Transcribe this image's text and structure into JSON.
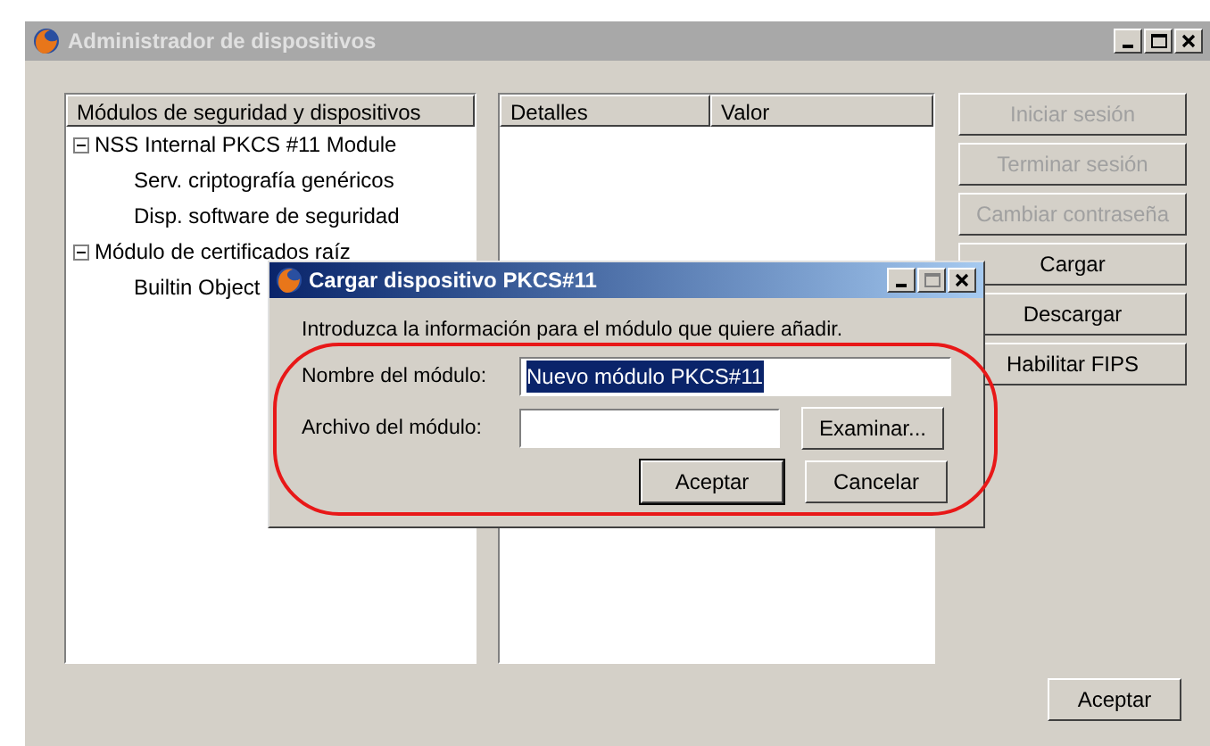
{
  "window": {
    "title": "Administrador de dispositivos"
  },
  "tree": {
    "columns": [
      "Módulos de seguridad y dispositivos"
    ],
    "items": [
      {
        "label": "NSS Internal PKCS #11 Module",
        "expanded": true,
        "children": [
          {
            "label": "Serv. criptografía genéricos"
          },
          {
            "label": "Disp. software de seguridad"
          }
        ]
      },
      {
        "label": "Módulo de certificados raíz",
        "expanded": true,
        "children": [
          {
            "label": "Builtin Object"
          }
        ]
      }
    ]
  },
  "details": {
    "columns": [
      "Detalles",
      "Valor"
    ]
  },
  "side_buttons": [
    {
      "label": "Iniciar sesión",
      "disabled": true
    },
    {
      "label": "Terminar sesión",
      "disabled": true
    },
    {
      "label": "Cambiar contraseña",
      "disabled": true
    },
    {
      "label": "Cargar",
      "disabled": false
    },
    {
      "label": "Descargar",
      "disabled": false
    },
    {
      "label": "Habilitar FIPS",
      "disabled": false
    }
  ],
  "ok_button": "Aceptar",
  "dialog": {
    "title": "Cargar dispositivo PKCS#11",
    "message": "Introduzca la información para el módulo que quiere añadir.",
    "fields": [
      {
        "label": "Nombre del módulo:",
        "value": "Nuevo módulo PKCS#11",
        "selected": true
      },
      {
        "label": "Archivo del módulo:",
        "button": "Examinar..."
      }
    ],
    "buttons": [
      {
        "label": "Aceptar",
        "default": true
      },
      {
        "label": "Cancelar",
        "default": false
      }
    ]
  },
  "annotation": {
    "kind": "ellipse",
    "color": "#e81818"
  }
}
